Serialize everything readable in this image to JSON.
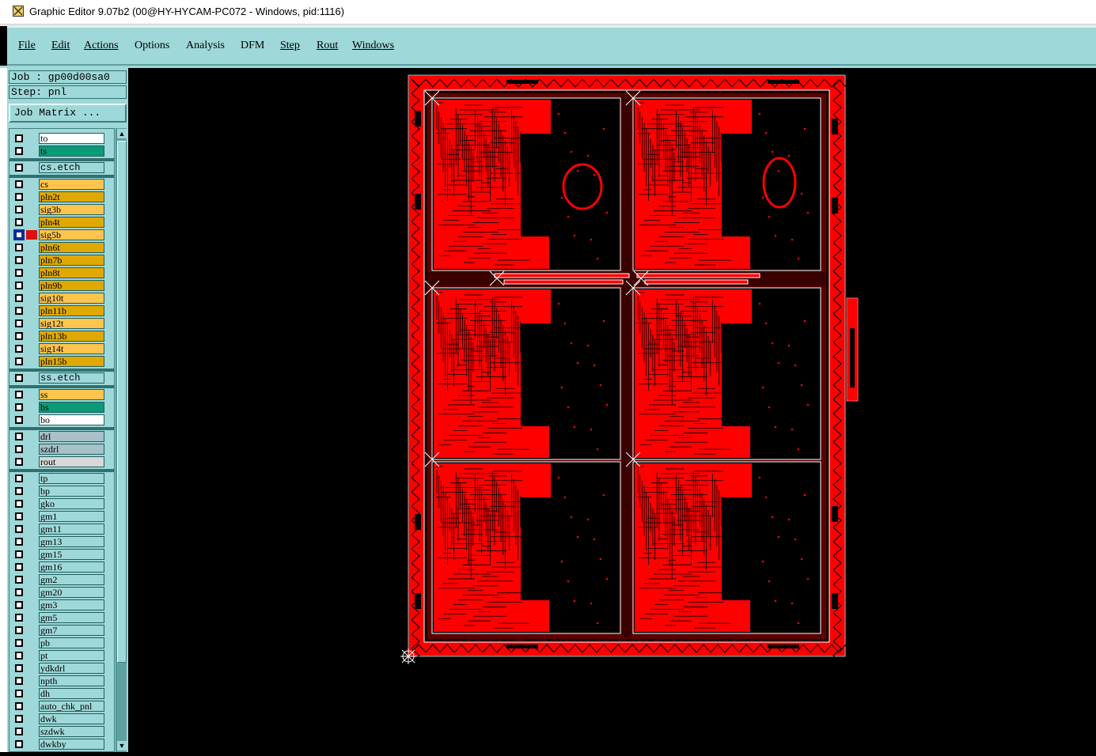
{
  "window": {
    "title": "Graphic Editor 9.07b2 (00@HY-HYCAM-PC072 - Windows, pid:1116)",
    "app_icon": "graphic-editor-icon"
  },
  "menu": [
    {
      "label": "File"
    },
    {
      "label": "Edit"
    },
    {
      "label": "Actions"
    },
    {
      "label": "Options"
    },
    {
      "label": "Analysis"
    },
    {
      "label": "DFM"
    },
    {
      "label": "Step"
    },
    {
      "label": "Rout"
    },
    {
      "label": "Windows"
    }
  ],
  "job": {
    "job_text": "Job : gp00d00sa0",
    "step_text": "Step: pnl",
    "job_matrix_label": "Job Matrix ..."
  },
  "layers": [
    {
      "name": "to",
      "color": "#ffffff"
    },
    {
      "name": "ts",
      "color": "#0b9a78"
    },
    {
      "name": "cs.etch",
      "color": "#9fd8d8"
    },
    {
      "name": "cs",
      "color": "#ffc44d"
    },
    {
      "name": "pln2t",
      "color": "#e0a800"
    },
    {
      "name": "sig3b",
      "color": "#ffc44d"
    },
    {
      "name": "pln4t",
      "color": "#e0a800"
    },
    {
      "name": "sig5b",
      "color": "#ffc44d",
      "selected": true
    },
    {
      "name": "pln6t",
      "color": "#e0a800"
    },
    {
      "name": "pln7b",
      "color": "#e0a800"
    },
    {
      "name": "pln8t",
      "color": "#e0a800"
    },
    {
      "name": "pln9b",
      "color": "#e0a800"
    },
    {
      "name": "sig10t",
      "color": "#ffc44d"
    },
    {
      "name": "pln11b",
      "color": "#e0a800"
    },
    {
      "name": "sig12t",
      "color": "#ffc44d"
    },
    {
      "name": "pln13b",
      "color": "#e0a800"
    },
    {
      "name": "sig14t",
      "color": "#ffc44d"
    },
    {
      "name": "pln15b",
      "color": "#e0a800"
    },
    {
      "name": "ss.etch",
      "color": "#9fd8d8"
    },
    {
      "name": "ss",
      "color": "#ffc44d"
    },
    {
      "name": "bs",
      "color": "#0b9a78"
    },
    {
      "name": "bo",
      "color": "#ffffff"
    },
    {
      "name": "drl",
      "color": "#a8c0c8"
    },
    {
      "name": "szdrl",
      "color": "#a8c0c8"
    },
    {
      "name": "rout",
      "color": "#d8d8d8"
    },
    {
      "name": "tp",
      "color": "#9fd8d8"
    },
    {
      "name": "bp",
      "color": "#9fd8d8"
    },
    {
      "name": "gko",
      "color": "#9fd8d8"
    },
    {
      "name": "gm1",
      "color": "#9fd8d8"
    },
    {
      "name": "gm11",
      "color": "#9fd8d8"
    },
    {
      "name": "gm13",
      "color": "#9fd8d8"
    },
    {
      "name": "gm15",
      "color": "#9fd8d8"
    },
    {
      "name": "gm16",
      "color": "#9fd8d8"
    },
    {
      "name": "gm2",
      "color": "#9fd8d8"
    },
    {
      "name": "gm20",
      "color": "#9fd8d8"
    },
    {
      "name": "gm3",
      "color": "#9fd8d8"
    },
    {
      "name": "gm5",
      "color": "#9fd8d8"
    },
    {
      "name": "gm7",
      "color": "#9fd8d8"
    },
    {
      "name": "pb",
      "color": "#9fd8d8"
    },
    {
      "name": "pt",
      "color": "#9fd8d8"
    },
    {
      "name": "ydkdrl",
      "color": "#9fd8d8"
    },
    {
      "name": "npth",
      "color": "#9fd8d8"
    },
    {
      "name": "dh",
      "color": "#9fd8d8"
    },
    {
      "name": "auto_chk_pnl",
      "color": "#9fd8d8"
    },
    {
      "name": "dwk",
      "color": "#9fd8d8"
    },
    {
      "name": "szdwk",
      "color": "#9fd8d8"
    },
    {
      "name": "dwkby",
      "color": "#9fd8d8"
    }
  ],
  "canvas": {
    "background": "#000000",
    "copper_color": "#ff0000",
    "outline_color": "#ffffff"
  }
}
